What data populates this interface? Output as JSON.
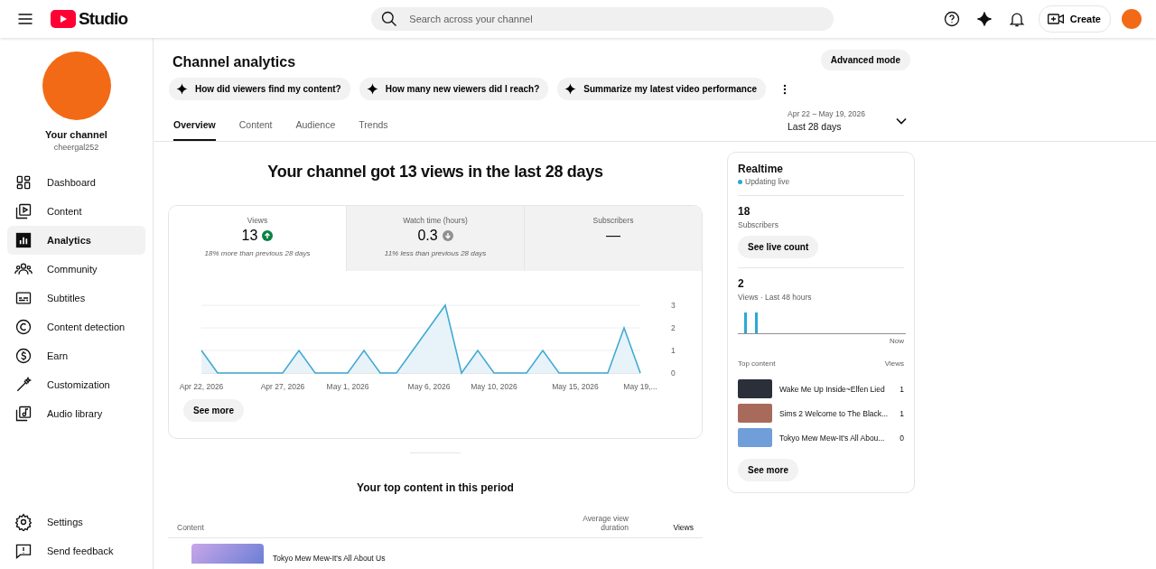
{
  "topbar": {
    "logo_text": "Studio",
    "search": {
      "placeholder": "Search across your channel"
    },
    "create_label": "Create"
  },
  "sidebar": {
    "channel_name": "Your channel",
    "channel_handle": "cheergal252",
    "items": [
      {
        "label": "Dashboard",
        "selected": false
      },
      {
        "label": "Content",
        "selected": false
      },
      {
        "label": "Analytics",
        "selected": true
      },
      {
        "label": "Community",
        "selected": false
      },
      {
        "label": "Subtitles",
        "selected": false
      },
      {
        "label": "Content detection",
        "selected": false
      },
      {
        "label": "Earn",
        "selected": false
      },
      {
        "label": "Customization",
        "selected": false
      },
      {
        "label": "Audio library",
        "selected": false
      }
    ],
    "bottom_items": [
      {
        "label": "Settings"
      },
      {
        "label": "Send feedback"
      }
    ]
  },
  "page": {
    "title": "Channel analytics",
    "advanced_button": "Advanced mode",
    "chips": [
      "How did viewers find my content?",
      "How many new viewers did I reach?",
      "Summarize my latest video performance"
    ],
    "tabs": [
      {
        "label": "Overview",
        "selected": true
      },
      {
        "label": "Content",
        "selected": false
      },
      {
        "label": "Audience",
        "selected": false
      },
      {
        "label": "Trends",
        "selected": false
      }
    ],
    "date_range": {
      "range": "Apr 22 – May 19, 2026",
      "label": "Last 28 days"
    }
  },
  "overview": {
    "headline": "Your channel got 13 views in the last 28 days",
    "metrics": [
      {
        "label": "Views",
        "value": "13",
        "kind": "up",
        "note": "18% more than previous 28 days",
        "selected": true
      },
      {
        "label": "Watch time (hours)",
        "value": "0.3",
        "kind": "down",
        "note": "11% less than previous 28 days",
        "selected": false
      },
      {
        "label": "Subscribers",
        "value": "—",
        "kind": "flat",
        "selected": false
      }
    ],
    "chart_data": {
      "type": "area",
      "values": [
        1,
        0,
        0,
        0,
        0,
        0,
        1,
        0,
        0,
        0,
        1,
        0,
        0,
        1,
        2,
        3,
        0,
        1,
        0,
        0,
        0,
        1,
        0,
        0,
        0,
        0,
        2,
        0
      ],
      "categories": [
        "Apr 22, 2026",
        null,
        null,
        null,
        null,
        "Apr 27, 2026",
        null,
        null,
        null,
        "May 1, 2026",
        null,
        null,
        null,
        null,
        "May 6, 2026",
        null,
        null,
        null,
        "May 10, 2026",
        null,
        null,
        null,
        null,
        "May 15, 2026",
        null,
        null,
        null,
        "May 19,..."
      ],
      "yticks": [
        0,
        1,
        2,
        3
      ],
      "ylim": [
        0,
        3
      ]
    },
    "see_more": "See more"
  },
  "top_content": {
    "title": "Your top content in this period",
    "columns": [
      "Content",
      "Average view duration",
      "Views"
    ],
    "rows": [
      {
        "title": "Tokyo Mew Mew-It's All About Us"
      }
    ]
  },
  "realtime": {
    "title": "Realtime",
    "status": "Updating live",
    "subscribers": "18",
    "subscribers_label": "Subscribers",
    "live_button": "See live count",
    "views": "2",
    "views_label": "Views · Last 48 hours",
    "chart_end_label": "Now",
    "top_label": "Top content",
    "views_col": "Views",
    "items": [
      {
        "title": "Wake Me Up Inside~Elfen Lied",
        "views": "1"
      },
      {
        "title": "Sims 2 Welcome to The Black...",
        "views": "1"
      },
      {
        "title": "Tokyo Mew Mew-It's All Abou...",
        "views": "0"
      }
    ],
    "see_more": "See more"
  }
}
